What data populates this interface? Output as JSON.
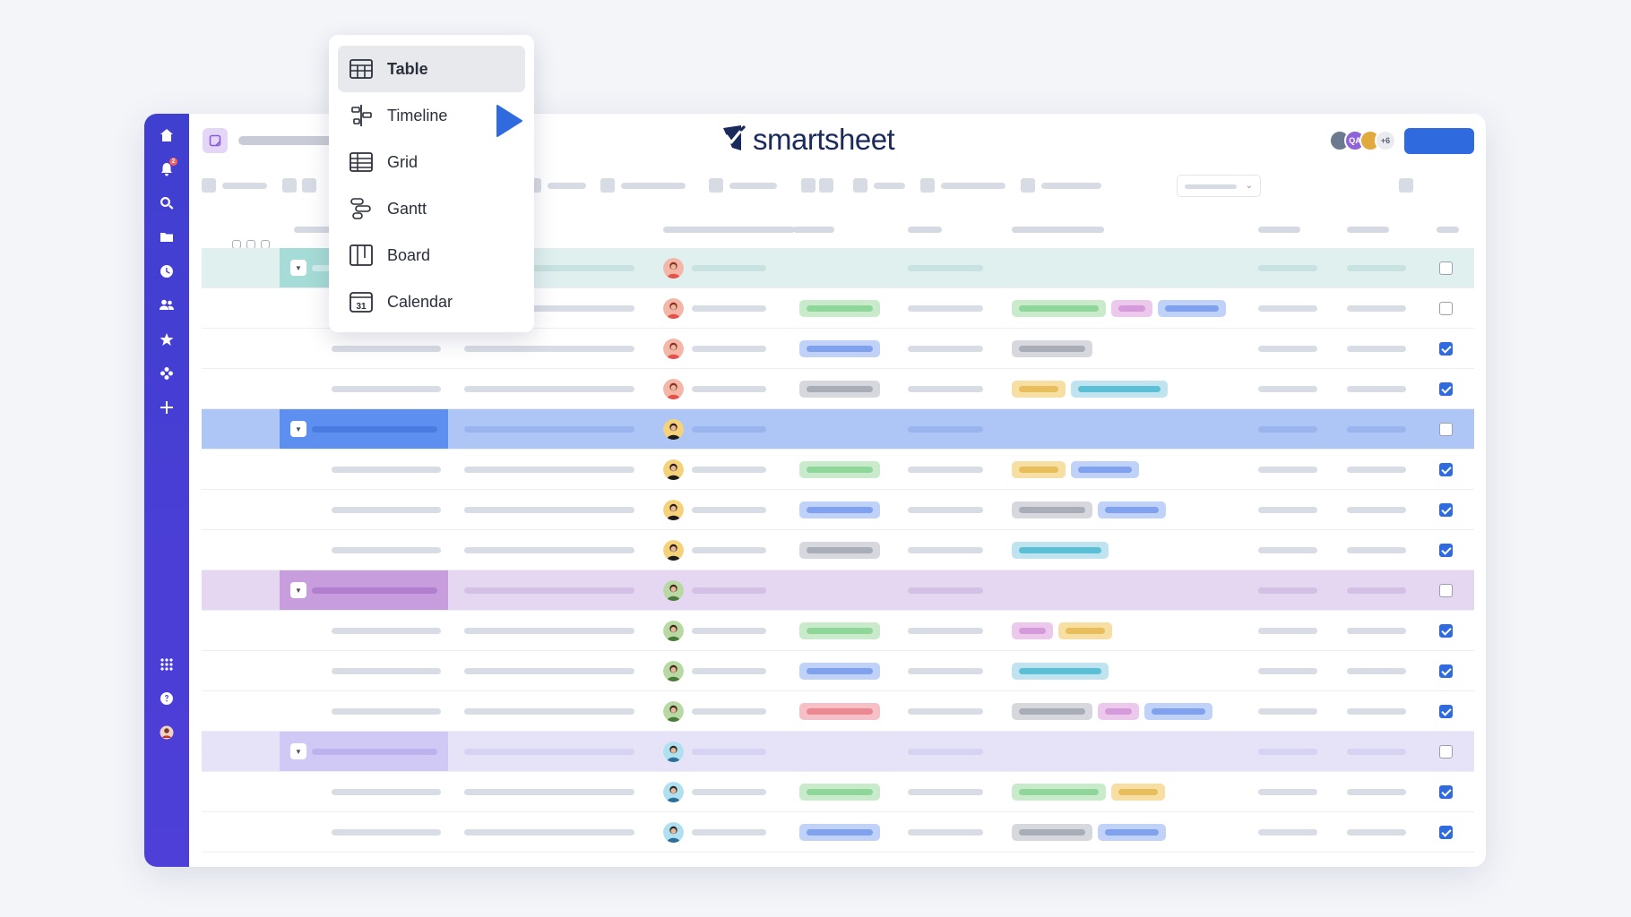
{
  "brand": {
    "name": "smartsheet",
    "color": "#1b2a5c"
  },
  "colors": {
    "rail": "#4340d3",
    "accent": "#2f6bdf",
    "menu_selected": "#e8e9ed"
  },
  "collaborators": [
    {
      "initials": "",
      "color": "#6b7a8f"
    },
    {
      "initials": "QA",
      "color": "#8e64d8"
    },
    {
      "initials": "",
      "color": "#e2a93c"
    },
    {
      "initials": "+6",
      "color": "#e9ebf0"
    }
  ],
  "rail_icons": [
    {
      "name": "home-icon",
      "badge": ""
    },
    {
      "name": "bell-icon",
      "badge": "2"
    },
    {
      "name": "search-icon",
      "badge": ""
    },
    {
      "name": "folder-icon",
      "badge": ""
    },
    {
      "name": "clock-icon",
      "badge": ""
    },
    {
      "name": "people-icon",
      "badge": ""
    },
    {
      "name": "star-icon",
      "badge": ""
    },
    {
      "name": "solutions-icon",
      "badge": ""
    },
    {
      "name": "plus-icon",
      "badge": ""
    },
    {
      "name": "apps-grid-icon",
      "badge": ""
    },
    {
      "name": "help-icon",
      "badge": ""
    },
    {
      "name": "profile-avatar",
      "badge": ""
    }
  ],
  "view_menu": {
    "selected": "Table",
    "items": [
      {
        "label": "Table",
        "icon": "table-icon"
      },
      {
        "label": "Timeline",
        "icon": "timeline-icon"
      },
      {
        "label": "Grid",
        "icon": "grid-icon"
      },
      {
        "label": "Gantt",
        "icon": "gantt-icon"
      },
      {
        "label": "Board",
        "icon": "board-icon"
      },
      {
        "label": "Calendar",
        "icon": "calendar-icon",
        "glyph": "31"
      }
    ]
  },
  "rows": [
    {
      "type": "parent",
      "group": "teal",
      "avatar": "red",
      "checked": false
    },
    {
      "type": "child",
      "avatar": "red",
      "status": [
        "green"
      ],
      "tags": [
        "green",
        "pink",
        "blue"
      ],
      "checked": false
    },
    {
      "type": "child",
      "avatar": "red",
      "status": [
        "blue"
      ],
      "tags": [
        "gray"
      ],
      "checked": true
    },
    {
      "type": "child",
      "avatar": "red",
      "status": [
        "gray"
      ],
      "tags": [
        "yellow",
        "cyan"
      ],
      "checked": true
    },
    {
      "type": "parent",
      "group": "blue",
      "avatar": "yellow",
      "checked": false
    },
    {
      "type": "child",
      "avatar": "yellow",
      "status": [
        "green"
      ],
      "tags": [
        "yellow",
        "blue"
      ],
      "checked": true
    },
    {
      "type": "child",
      "avatar": "yellow",
      "status": [
        "blue"
      ],
      "tags": [
        "gray",
        "blue"
      ],
      "checked": true
    },
    {
      "type": "child",
      "avatar": "yellow",
      "status": [
        "gray"
      ],
      "tags": [
        "cyan"
      ],
      "checked": true
    },
    {
      "type": "parent",
      "group": "purple",
      "avatar": "green",
      "checked": false
    },
    {
      "type": "child",
      "avatar": "green",
      "status": [
        "green"
      ],
      "tags": [
        "pink",
        "yellow"
      ],
      "checked": true
    },
    {
      "type": "child",
      "avatar": "green",
      "status": [
        "blue"
      ],
      "tags": [
        "cyan"
      ],
      "checked": true
    },
    {
      "type": "child",
      "avatar": "green",
      "status": [
        "red"
      ],
      "tags": [
        "gray",
        "pink",
        "blue"
      ],
      "checked": true
    },
    {
      "type": "parent",
      "group": "lav",
      "avatar": "teal",
      "checked": false
    },
    {
      "type": "child",
      "avatar": "teal",
      "status": [
        "green"
      ],
      "tags": [
        "green",
        "yellow"
      ],
      "checked": true
    },
    {
      "type": "child",
      "avatar": "teal",
      "status": [
        "blue"
      ],
      "tags": [
        "gray",
        "blue"
      ],
      "checked": true
    }
  ]
}
